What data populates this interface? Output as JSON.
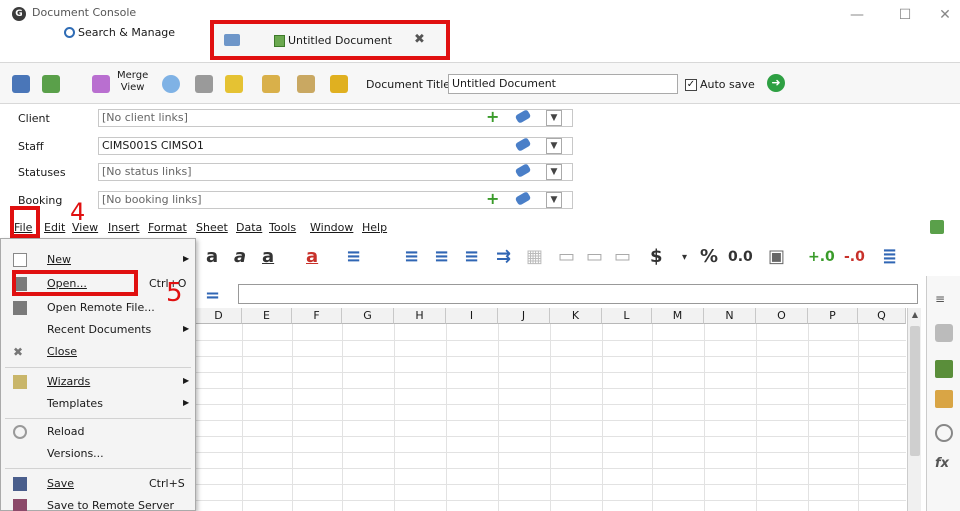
{
  "window": {
    "title": "Document Console",
    "minimize": "—",
    "maximize": "☐",
    "close": "✕"
  },
  "tabs": {
    "search_label": "Search & Manage",
    "doc_label": "Untitled Document",
    "doc_close": "✖"
  },
  "toolbar": {
    "merge_view_label_1": "Merge",
    "merge_view_label_2": "View",
    "document_title_label": "Document Title",
    "document_title_value": "Untitled Document",
    "autosave_label": "Auto save",
    "autosave_check": "✓",
    "go_glyph": "➜"
  },
  "links": [
    {
      "label": "Client",
      "value": "[No client links]",
      "has_add": true
    },
    {
      "label": "Staff",
      "value": "CIMS001S CIMSO1",
      "has_add": false
    },
    {
      "label": "Statuses",
      "value": "[No status links]",
      "has_add": false
    },
    {
      "label": "Booking",
      "value": "[No booking links]",
      "has_add": true
    }
  ],
  "menubar": [
    "File",
    "Edit",
    "View",
    "Insert",
    "Format",
    "Sheet",
    "Data",
    "Tools",
    "Window",
    "Help"
  ],
  "annotations": {
    "step4": "4",
    "step5": "5"
  },
  "format_bar": {
    "dollar": "$",
    "percent": "%",
    "decimal": "0.0"
  },
  "columns": [
    "D",
    "E",
    "F",
    "G",
    "H",
    "I",
    "J",
    "K",
    "L",
    "M",
    "N",
    "O",
    "P",
    "Q"
  ],
  "file_menu": [
    {
      "label": "New",
      "shortcut": "",
      "arrow": true
    },
    {
      "label": "Open...",
      "shortcut": "Ctrl+O",
      "arrow": false
    },
    {
      "label": "Open Remote File...",
      "shortcut": "",
      "arrow": false
    },
    {
      "label": "Recent Documents",
      "shortcut": "",
      "arrow": true
    },
    {
      "label": "Close",
      "shortcut": "",
      "arrow": false
    },
    {
      "label": "Wizards",
      "shortcut": "",
      "arrow": true
    },
    {
      "label": "Templates",
      "shortcut": "",
      "arrow": true
    },
    {
      "label": "Reload",
      "shortcut": "",
      "arrow": false
    },
    {
      "label": "Versions...",
      "shortcut": "",
      "arrow": false
    },
    {
      "label": "Save",
      "shortcut": "Ctrl+S",
      "arrow": false
    },
    {
      "label": "Save to Remote Server",
      "shortcut": "",
      "arrow": false
    }
  ],
  "colors": {
    "highlight_red": "#e01010",
    "accent_blue": "#2f6cb5",
    "add_green": "#3a9b2a"
  }
}
